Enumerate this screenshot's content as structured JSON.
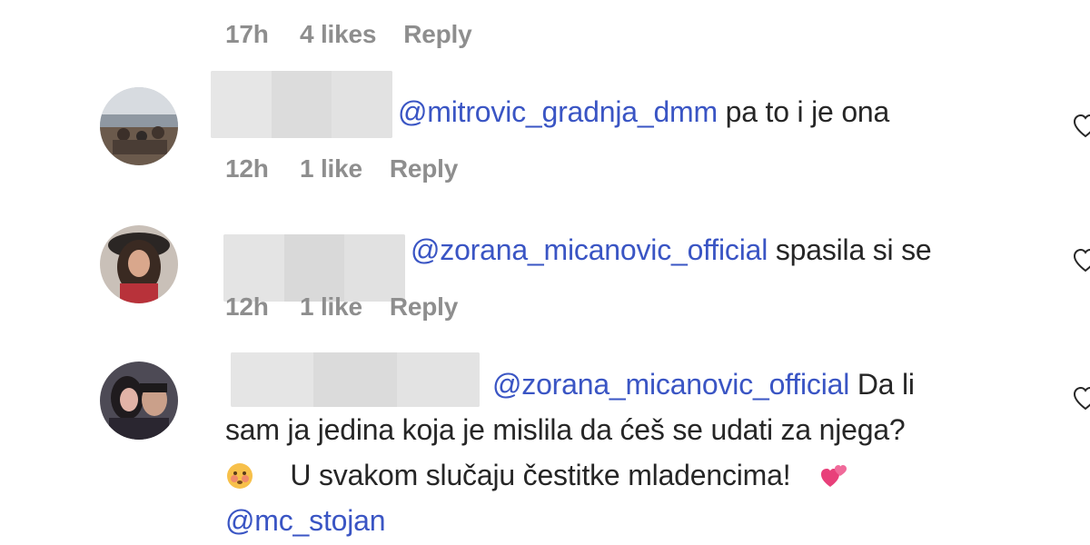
{
  "top_meta": {
    "time": "17h",
    "likes": "4 likes",
    "reply": "Reply"
  },
  "comments": [
    {
      "mention": "@mitrovic_gradnja_dmm",
      "text": "pa to i je ona",
      "meta": {
        "time": "12h",
        "likes": "1 like",
        "reply": "Reply"
      }
    },
    {
      "mention": "@zorana_micanovic_official",
      "text": "spasila si se",
      "meta": {
        "time": "12h",
        "likes": "1 like",
        "reply": "Reply"
      }
    },
    {
      "mention": "@zorana_micanovic_official",
      "lines": [
        "Da li",
        "sam ja jedina koja je mislila da ćeš se udati za njega?",
        "U svakom slučaju čestitke mladencima!"
      ],
      "tag": "@mc_stojan"
    }
  ],
  "icons": {
    "like": "heart-outline-icon",
    "emoji_face": "flushed-face-emoji",
    "emoji_hearts": "two-hearts-emoji"
  },
  "colors": {
    "mention": "#3a55c4",
    "meta": "#8e8e8e",
    "text": "#262626",
    "redaction": "#e3e3e3"
  }
}
